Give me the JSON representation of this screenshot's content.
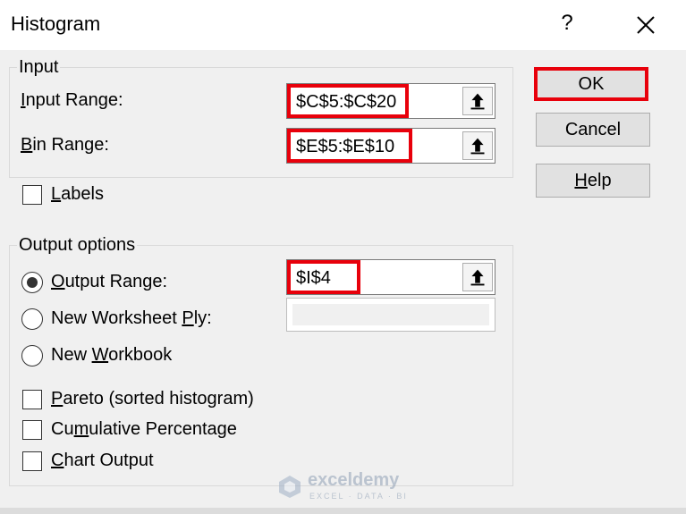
{
  "dialog": {
    "title": "Histogram",
    "help_glyph": "?",
    "close_icon": "close-icon"
  },
  "input_group": {
    "label": "Input",
    "input_range": {
      "label_u": "I",
      "label_rest": "nput Range:",
      "value": "$C$5:$C$20"
    },
    "bin_range": {
      "label_u": "B",
      "label_rest": "in Range:",
      "value": "$E$5:$E$10"
    },
    "labels_checkbox": {
      "label_u": "L",
      "label_rest": "abels",
      "checked": false
    }
  },
  "output_group": {
    "label": "Output options",
    "output_range": {
      "label_u": "O",
      "label_rest": "utput Range:",
      "value": "$I$4",
      "selected": true
    },
    "new_worksheet": {
      "label_pre": "New Worksheet ",
      "label_u": "P",
      "label_rest": "ly:",
      "selected": false,
      "value": ""
    },
    "new_workbook": {
      "label_pre": "New ",
      "label_u": "W",
      "label_rest": "orkbook",
      "selected": false
    },
    "pareto": {
      "label_u": "P",
      "label_rest": "areto (sorted histogram)",
      "checked": false
    },
    "cumulative": {
      "label_pre": "Cu",
      "label_u": "m",
      "label_rest": "ulative Percentage",
      "checked": false
    },
    "chart_output": {
      "label_u": "C",
      "label_rest": "hart Output",
      "checked": false
    }
  },
  "buttons": {
    "ok": "OK",
    "cancel": "Cancel",
    "help_u": "H",
    "help_rest": "elp"
  },
  "watermark": {
    "name": "exceldemy",
    "tagline": "EXCEL · DATA · BI"
  },
  "colors": {
    "highlight": "#e8000b",
    "dialog_bg": "#f0f0f0"
  }
}
